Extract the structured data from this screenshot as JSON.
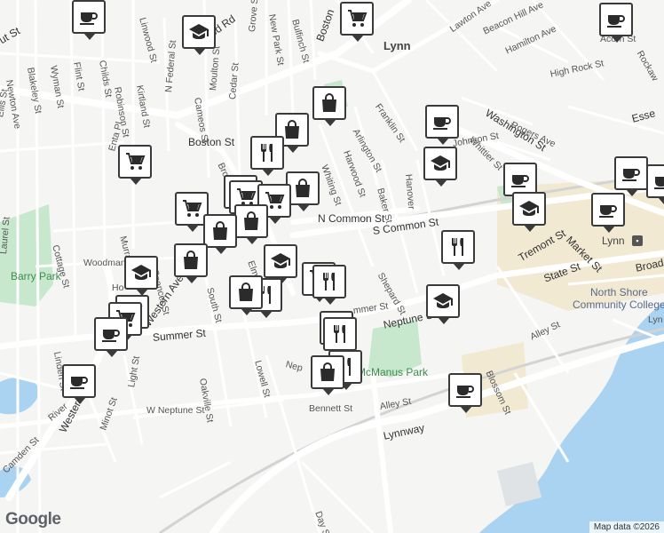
{
  "map": {
    "place_labels": {
      "lynn_north": "Lynn",
      "lynn_station": "Lynn"
    },
    "poi_labels": {
      "north_shore_college": "North Shore\nCommunity College"
    },
    "park_labels": {
      "barry_park": "Barry Park",
      "mcmanus_park": "McManus Park"
    },
    "streets": {
      "n_common": "N Common St",
      "s_common": "S Common St",
      "boston": "Boston St",
      "boston_top": "Boston",
      "washington": "Washington St",
      "western_top": "Western Ave",
      "western_bottom": "Western Ave",
      "summer": "Summer St",
      "neptune": "Neptune St",
      "w_neptune": "W Neptune St",
      "lynnway": "Lynnway",
      "tremont": "Tremont St",
      "state": "State St",
      "market": "Market St",
      "broad": "Broad",
      "bennett": "Bennett St",
      "alley_mid": "Alley St",
      "alley_right": "Alley St",
      "blossom": "Blossom St",
      "day": "Day St",
      "lowell": "Lowell St",
      "oakville": "Oakville St",
      "light": "Light St",
      "minot": "Minot St",
      "camden": "Camden St",
      "linden": "Linden St",
      "laurel": "Laurel St",
      "cottage": "Cottage St",
      "murray": "Murray St",
      "spencer": "Spencer St",
      "south": "South St",
      "elm": "Elm",
      "shepard": "Shepard St",
      "baker": "Baker St",
      "harwood": "Harwood St",
      "whiting": "Whiting St",
      "arlington": "Arlington St",
      "franklin": "Franklin St",
      "johnson": "Johnson St",
      "whittier": "Whittier St",
      "rogers": "Rogers Ave",
      "high_rock": "High Rock St",
      "hamilton": "Hamilton Ave",
      "beacon_hill": "Beacon Hill Ave",
      "lawton": "Lawton Ave",
      "acorn": "Acorn St",
      "rockaway": "Rockaw",
      "essex": "Esse",
      "lyn_right": "Lyn",
      "wood_rd": "ood Rd",
      "bulfinch": "Bulfinch St",
      "new_park": "New Park St",
      "grove": "Grove St",
      "linwood": "Linwood St",
      "childs": "Childs St",
      "flint": "Flint St",
      "wyman": "Wyman St",
      "newton": "Newton Ave",
      "blakeley": "Blakeley St",
      "robinson": "Robinson St",
      "kirtland": "Kirtland St",
      "n_federal": "N Federal St",
      "cameos": "Cameos St",
      "moulton": "Moulton St",
      "cedar": "Cedar St",
      "brook": "Brook",
      "woodman": "Woodman",
      "hanover": "Hanover",
      "enta": "Enta Pl",
      "ut_st": "ut St",
      "ellis": "Ellis St",
      "river": "River",
      "ho": "Ho",
      "nep": "Nep",
      "mmer": "mmer St",
      "ft": "F"
    },
    "markers": [
      {
        "name": "coffee",
        "label": "coffee-icon"
      },
      {
        "name": "shopping-cart",
        "label": "shopping-cart-icon"
      },
      {
        "name": "school",
        "label": "school-icon"
      },
      {
        "name": "shopping-bag",
        "label": "shopping-bag-icon"
      },
      {
        "name": "restaurant",
        "label": "restaurant-icon"
      }
    ],
    "attribution": "Map data ©2026",
    "logo": "Google",
    "colors": {
      "land": "#f5f5f3",
      "water": "#a9d3f0",
      "park": "#c7e8cc",
      "commercial": "#f1e9d2",
      "road": "#ffffff",
      "pin_border": "#3a3a3a"
    }
  }
}
